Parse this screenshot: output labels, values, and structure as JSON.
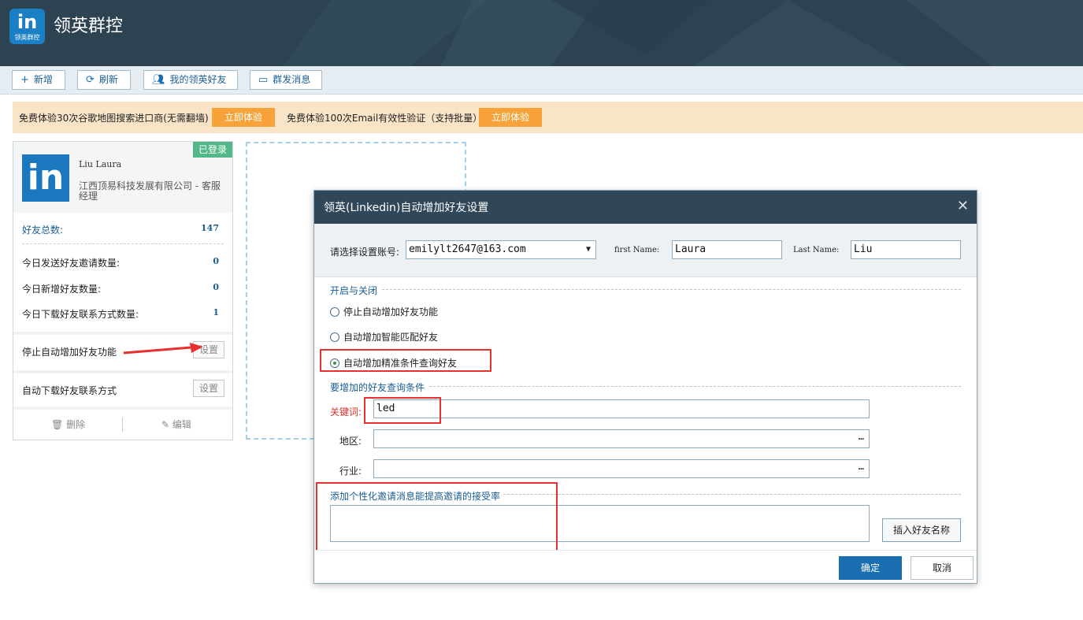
{
  "app": {
    "title": "领英群控",
    "logo_text": "in",
    "logo_sub": "领英群控"
  },
  "toolbar": {
    "add": "新增",
    "refresh": "刷新",
    "friends": "我的领英好友",
    "broadcast": "群发消息"
  },
  "banner": {
    "text1": "免费体验30次谷歌地图搜索进口商(无需翻墙)",
    "btn1": "立即体验",
    "text2": "免费体验100次Email有效性验证（支持批量）",
    "btn2": "立即体验"
  },
  "card": {
    "status": "已登录",
    "name": "Liu Laura",
    "company": "江西顶易科技发展有限公司 - 客服经理",
    "total_label": "好友总数:",
    "total_value": "147",
    "stats": [
      {
        "label": "今日发送好友邀请数量:",
        "value": "0"
      },
      {
        "label": "今日新增好友数量:",
        "value": "0"
      },
      {
        "label": "今日下载好友联系方式数量:",
        "value": "1"
      }
    ],
    "auto_add_label": "停止自动增加好友功能",
    "auto_add_btn": "设置",
    "auto_download_label": "自动下载好友联系方式",
    "auto_download_btn": "设置",
    "delete": "删除",
    "edit": "编辑"
  },
  "dialog": {
    "title": "领英(Linkedin)自动增加好友设置",
    "account_label": "请选择设置账号:",
    "account_value": "emilylt2647@163.com",
    "first_name_label": "first Name:",
    "first_name_value": "Laura",
    "last_name_label": "Last Name:",
    "last_name_value": "Liu",
    "toggle_group": "开启与关闭",
    "options": [
      "停止自动增加好友功能",
      "自动增加智能匹配好友",
      "自动增加精准条件查询好友"
    ],
    "selected_option": 2,
    "criteria_group": "要增加的好友查询条件",
    "keyword_label": "关键词:",
    "keyword_value": "led",
    "region_label": "地区:",
    "industry_label": "行业:",
    "message_group": "添加个性化邀请消息能提高邀请的接受率",
    "message_value": "",
    "insert_btn": "插入好友名称",
    "ok": "确定",
    "cancel": "取消"
  },
  "colors": {
    "header_bg": "#2d4352",
    "accent": "#1a6fb0",
    "banner_bg": "#f9e4c8",
    "banner_btn": "#f7a33a",
    "highlight": "#e8302f",
    "badge": "#52b88a"
  }
}
